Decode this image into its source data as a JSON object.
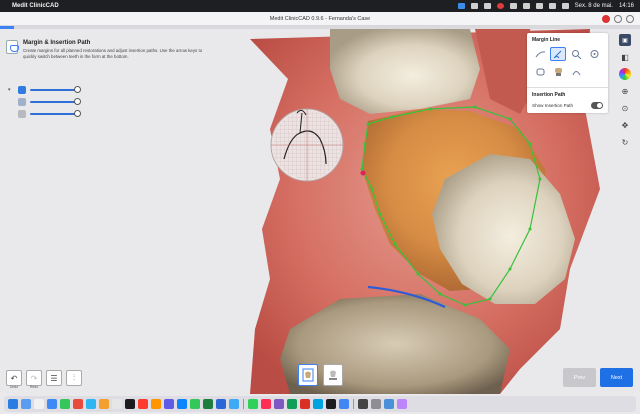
{
  "menubar": {
    "app_name": "Medit ClinicCAD",
    "date": "Sex. 8 de mai.",
    "time": "14:16"
  },
  "window": {
    "title": "Medit ClinicCAD 0.9.6 - Fernanda's Case"
  },
  "left_panel": {
    "title": "Margin & Insertion Path",
    "description": "Create margins for all planned restorations and adjust insertion paths. Use the arrow keys to quickly switch between teeth in the form at the bottom."
  },
  "right_panel": {
    "margin_line_title": "Margin Line",
    "insertion_path_title": "Insertion Path",
    "show_insertion_path_label": "Show Insertion Path"
  },
  "bottom_tools": {
    "undo_label": "Undo",
    "redo_label": "Redo"
  },
  "buttons": {
    "prev_label": "Prev",
    "next_label": "Next"
  },
  "dock_colors": [
    "#2a7de1",
    "#5b9bf0",
    "#f2f2f2",
    "#3d8af7",
    "#35c759",
    "#e84b3c",
    "#2fb6f0",
    "#f4a02e",
    "#e6e6e6",
    "#1c1c1e",
    "#ff3b30",
    "#ff9500",
    "#5e5ce6",
    "#0a84ff",
    "#34c759",
    "#1e7e3e",
    "#2a67d6",
    "#3fa9f5",
    "#30d158",
    "#ff2d55",
    "#7e57c2",
    "#0f9d58",
    "#d93025",
    "#00a3e0",
    "#1d1d1f",
    "#4285f4",
    "#444",
    "#8e8e93",
    "#4a90d9",
    "#bb86fc"
  ]
}
